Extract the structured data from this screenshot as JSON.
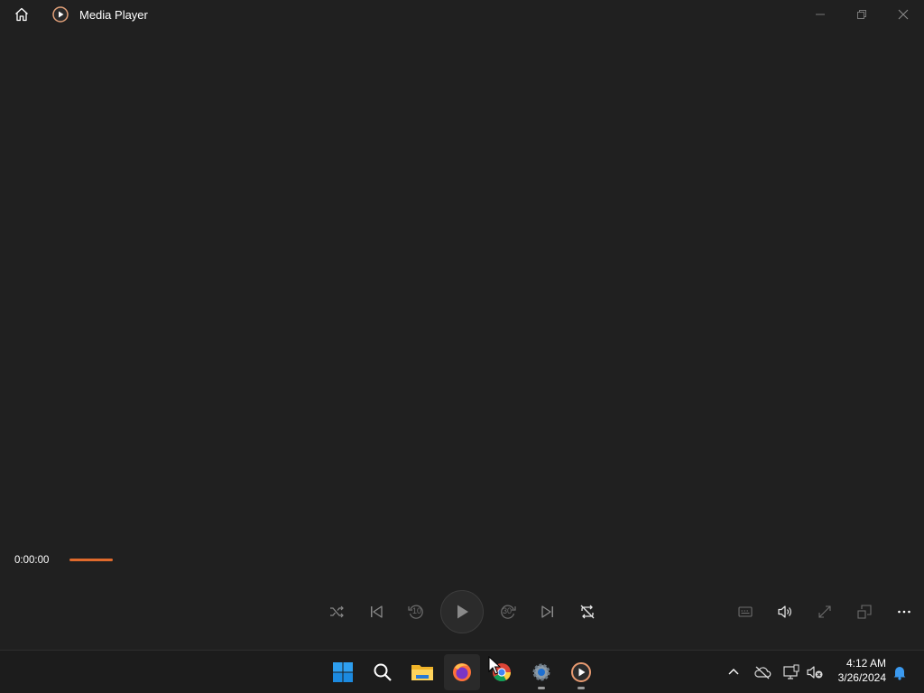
{
  "app": {
    "title": "Media Player"
  },
  "window": {
    "minimize_icon": "minimize-icon",
    "maximize_icon": "restore-icon",
    "close_icon": "close-icon"
  },
  "player": {
    "elapsed": "0:00:00",
    "progress_fraction": 0.0,
    "controls": [
      "shuffle",
      "previous",
      "rewind-10",
      "play",
      "forward-30",
      "next",
      "repeat"
    ],
    "rewind_label": "10",
    "forward_label": "30",
    "right_controls": [
      "captions",
      "volume",
      "fullscreen",
      "mini-player",
      "more-options"
    ]
  },
  "colors": {
    "accent": "#e06a2c",
    "background": "#202020",
    "taskbar": "#1c1c1c"
  },
  "taskbar": {
    "apps": [
      "start",
      "search",
      "file-explorer",
      "firefox",
      "chrome",
      "settings",
      "media-player"
    ],
    "time": "4:12 AM",
    "date": "3/26/2024"
  }
}
